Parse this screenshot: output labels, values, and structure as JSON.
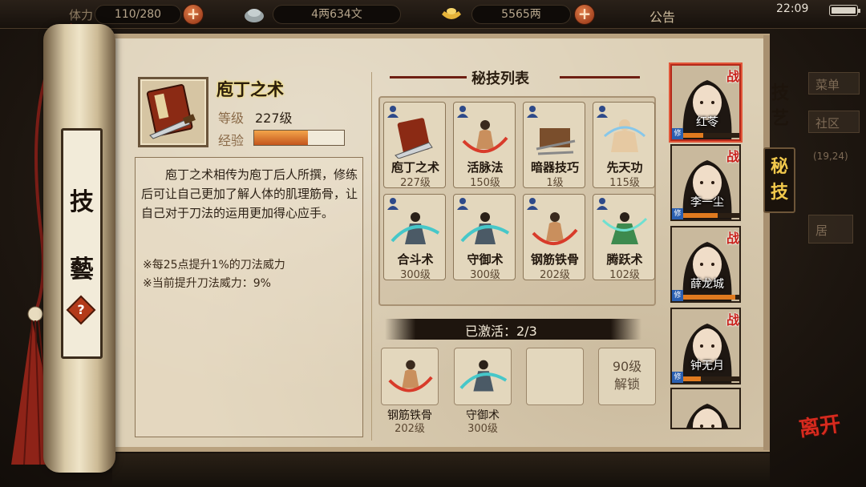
{
  "topbar": {
    "stamina_label": "体力",
    "stamina": "110/280",
    "coins": "4两634文",
    "silver": "5565两",
    "notice": "公告",
    "time": "22:09"
  },
  "rod": {
    "label_top": "技",
    "label_bottom": "藝",
    "help": "?"
  },
  "skill": {
    "title": "庖丁之术",
    "level_label": "等级",
    "level_value": "227级",
    "exp_label": "经验",
    "exp_fraction": 0.6,
    "description": "庖丁之术相传为庖丁后人所撰，修练后可让自己更加了解人体的肌理筋骨，让自己对于刀法的运用更加得心应手。",
    "note1": "※每25点提升1%的刀法威力",
    "note2": "※当前提升刀法威力：9%"
  },
  "list": {
    "title": "秘技列表",
    "cards": [
      {
        "name": "庖丁之术",
        "level": "227级"
      },
      {
        "name": "活脉法",
        "level": "150级"
      },
      {
        "name": "暗器技巧",
        "level": "1级"
      },
      {
        "name": "先天功",
        "level": "115级"
      },
      {
        "name": "合斗术",
        "level": "300级"
      },
      {
        "name": "守御术",
        "level": "300级"
      },
      {
        "name": "钢筋铁骨",
        "level": "202级"
      },
      {
        "name": "腾跃术",
        "level": "102级"
      }
    ]
  },
  "activated": {
    "text": "已激活：2/3",
    "slots": [
      {
        "name": "钢筋铁骨",
        "level": "202级"
      },
      {
        "name": "守御术",
        "level": "300级"
      }
    ],
    "lock_line1": "90级",
    "lock_line2": "解锁"
  },
  "tabs": {
    "skill": "技艺",
    "secret": "秘技"
  },
  "party": [
    {
      "name": "红苓",
      "hp": 0.35,
      "tag": "战",
      "badge": "修"
    },
    {
      "name": "李一尘",
      "hp": 0.6,
      "tag": "战",
      "badge": "修"
    },
    {
      "name": "薛龙城",
      "hp": 0.9,
      "tag": "战",
      "badge": "修"
    },
    {
      "name": "钟无月",
      "hp": 0.3,
      "tag": "战",
      "badge": "修"
    },
    {
      "name": "",
      "hp": 0.0,
      "tag": "",
      "badge": ""
    }
  ],
  "side_right": {
    "btn1": "菜单",
    "btn2": "社区",
    "coord": "(19,24)",
    "btn3": "居"
  },
  "leave": "离开",
  "colors": {
    "accent_red": "#b3281a",
    "parchment": "#ddd0b6",
    "gold_tab": "#f2c94c"
  }
}
